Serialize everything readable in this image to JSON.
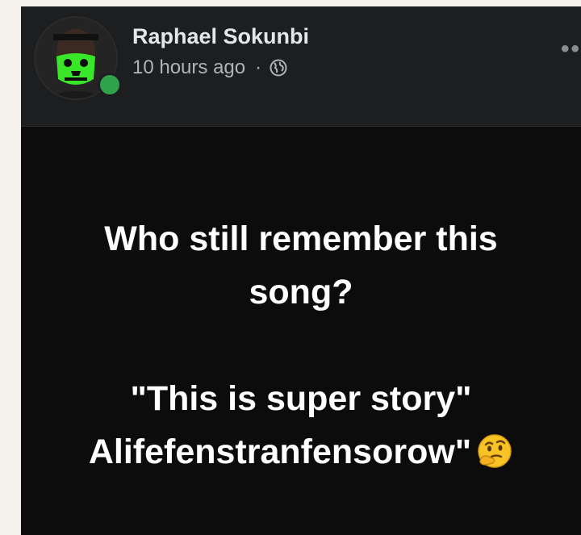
{
  "post": {
    "author": "Raphael Sokunbi",
    "timestamp": "10 hours ago",
    "separator": "·",
    "privacy_icon": "globe-icon",
    "more_label": "••",
    "online_color": "#31a24c",
    "lines": [
      "Who still remember this",
      "song?",
      "\"This is super story\"",
      "Alifefenstranfensorow\""
    ],
    "emoji": "thinking-face-icon"
  }
}
